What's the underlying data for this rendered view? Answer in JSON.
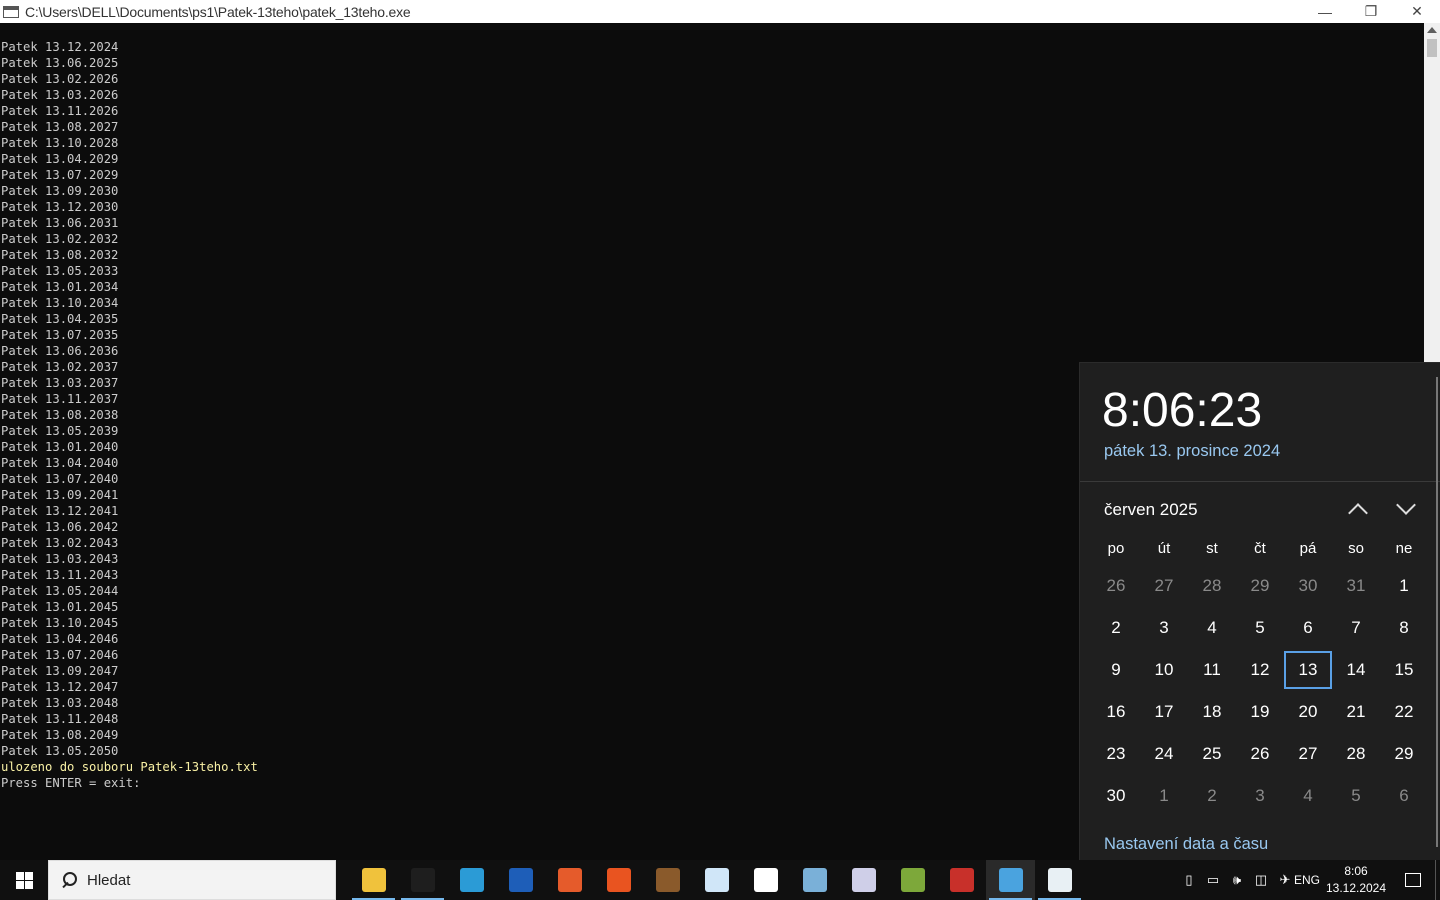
{
  "window": {
    "title": "C:\\Users\\DELL\\Documents\\ps1\\Patek-13teho\\patek_13teho.exe",
    "minimize": "—",
    "maximize": "❐",
    "close": "✕"
  },
  "console": {
    "lines": [
      "Patek 13.12.2024",
      "Patek 13.06.2025",
      "Patek 13.02.2026",
      "Patek 13.03.2026",
      "Patek 13.11.2026",
      "Patek 13.08.2027",
      "Patek 13.10.2028",
      "Patek 13.04.2029",
      "Patek 13.07.2029",
      "Patek 13.09.2030",
      "Patek 13.12.2030",
      "Patek 13.06.2031",
      "Patek 13.02.2032",
      "Patek 13.08.2032",
      "Patek 13.05.2033",
      "Patek 13.01.2034",
      "Patek 13.10.2034",
      "Patek 13.04.2035",
      "Patek 13.07.2035",
      "Patek 13.06.2036",
      "Patek 13.02.2037",
      "Patek 13.03.2037",
      "Patek 13.11.2037",
      "Patek 13.08.2038",
      "Patek 13.05.2039",
      "Patek 13.01.2040",
      "Patek 13.04.2040",
      "Patek 13.07.2040",
      "Patek 13.09.2041",
      "Patek 13.12.2041",
      "Patek 13.06.2042",
      "Patek 13.02.2043",
      "Patek 13.03.2043",
      "Patek 13.11.2043",
      "Patek 13.05.2044",
      "Patek 13.01.2045",
      "Patek 13.10.2045",
      "Patek 13.04.2046",
      "Patek 13.07.2046",
      "Patek 13.09.2047",
      "Patek 13.12.2047",
      "Patek 13.03.2048",
      "Patek 13.11.2048",
      "Patek 13.08.2049",
      "Patek 13.05.2050"
    ],
    "saved_msg": "ulozeno do souboru Patek-13teho.txt",
    "prompt": "Press ENTER = exit:"
  },
  "flyout": {
    "time": "8:06:23",
    "date": "pátek 13. prosince 2024",
    "month": "červen 2025",
    "weekdays": [
      "po",
      "út",
      "st",
      "čt",
      "pá",
      "so",
      "ne"
    ],
    "weeks": [
      [
        {
          "d": "26",
          "dim": true
        },
        {
          "d": "27",
          "dim": true
        },
        {
          "d": "28",
          "dim": true
        },
        {
          "d": "29",
          "dim": true
        },
        {
          "d": "30",
          "dim": true
        },
        {
          "d": "31",
          "dim": true
        },
        {
          "d": "1"
        }
      ],
      [
        {
          "d": "2"
        },
        {
          "d": "3"
        },
        {
          "d": "4"
        },
        {
          "d": "5"
        },
        {
          "d": "6"
        },
        {
          "d": "7"
        },
        {
          "d": "8"
        }
      ],
      [
        {
          "d": "9"
        },
        {
          "d": "10"
        },
        {
          "d": "11"
        },
        {
          "d": "12"
        },
        {
          "d": "13",
          "today": true
        },
        {
          "d": "14"
        },
        {
          "d": "15"
        }
      ],
      [
        {
          "d": "16"
        },
        {
          "d": "17"
        },
        {
          "d": "18"
        },
        {
          "d": "19"
        },
        {
          "d": "20"
        },
        {
          "d": "21"
        },
        {
          "d": "22"
        }
      ],
      [
        {
          "d": "23"
        },
        {
          "d": "24"
        },
        {
          "d": "25"
        },
        {
          "d": "26"
        },
        {
          "d": "27"
        },
        {
          "d": "28"
        },
        {
          "d": "29"
        }
      ],
      [
        {
          "d": "30"
        },
        {
          "d": "1",
          "dim": true
        },
        {
          "d": "2",
          "dim": true
        },
        {
          "d": "3",
          "dim": true
        },
        {
          "d": "4",
          "dim": true
        },
        {
          "d": "5",
          "dim": true
        },
        {
          "d": "6",
          "dim": true
        }
      ]
    ],
    "settings_link": "Nastavení data a času"
  },
  "taskbar": {
    "search_placeholder": "Hledat",
    "apps": [
      {
        "name": "file-explorer-icon",
        "color": "#f0c23c",
        "running": true
      },
      {
        "name": "command-prompt-icon",
        "color": "#1e1e1e",
        "running": true
      },
      {
        "name": "powershell-ise-icon",
        "color": "#2b9bd6",
        "running": false
      },
      {
        "name": "save-disk-icon",
        "color": "#1e5eb8",
        "running": false
      },
      {
        "name": "firefox-icon",
        "color": "#e55b2b",
        "running": false
      },
      {
        "name": "ubuntu-icon",
        "color": "#e95420",
        "running": false
      },
      {
        "name": "dosbox-icon",
        "color": "#8a5a2b",
        "running": false
      },
      {
        "name": "cloud-drive-icon",
        "color": "#d0e6f8",
        "running": false
      },
      {
        "name": "settings-gear-icon",
        "color": "#ffffff",
        "running": false
      },
      {
        "name": "tool-globe-icon",
        "color": "#7ab0d8",
        "running": false
      },
      {
        "name": "disc-burner-icon",
        "color": "#cfcfe8",
        "running": false
      },
      {
        "name": "media-player-icon",
        "color": "#7da83a",
        "running": false
      },
      {
        "name": "red-app-icon",
        "color": "#c8302a",
        "running": false
      },
      {
        "name": "control-panel-icon",
        "color": "#4aa3df",
        "running": true,
        "active": true
      },
      {
        "name": "console-window-icon",
        "color": "#e8f0f4",
        "running": true
      }
    ],
    "lang": "ENG",
    "time": "8:06",
    "date": "13.12.2024"
  }
}
